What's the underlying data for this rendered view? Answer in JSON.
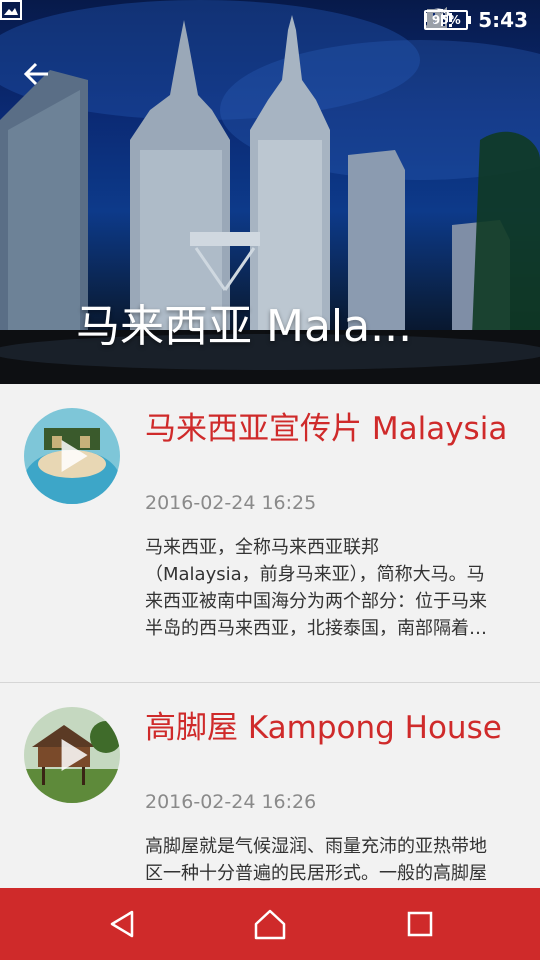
{
  "status_bar": {
    "battery": "95%",
    "time": "5:43"
  },
  "header": {
    "title": "马来西亚 Mala..."
  },
  "items": [
    {
      "title": "马来西亚宣传片 Malaysia",
      "date": "2016-02-24 16:25",
      "desc": "马来西亚，全称马来西亚联邦（Malaysia，前身马来亚），简称大马。马来西亚被南中国海分为两个部分：位于马来半岛的西马来西亚，北接泰国，南部隔着柔佛海峡，以新…"
    },
    {
      "title": "高脚屋 Kampong House",
      "date": "2016-02-24 16:26",
      "desc": "高脚屋就是气候湿润、雨量充沛的亚热带地区一种十分普遍的民居形式。一般的高脚屋下是多层楼底，目是住"
    }
  ],
  "colors": {
    "accent": "#cf2a2a",
    "date": "#8a8a8a",
    "background": "#f2f2f2"
  },
  "icons": {
    "back": "back-arrow-icon",
    "nav_back": "triangle-back-icon",
    "nav_home": "home-icon",
    "nav_recents": "square-recents-icon"
  }
}
